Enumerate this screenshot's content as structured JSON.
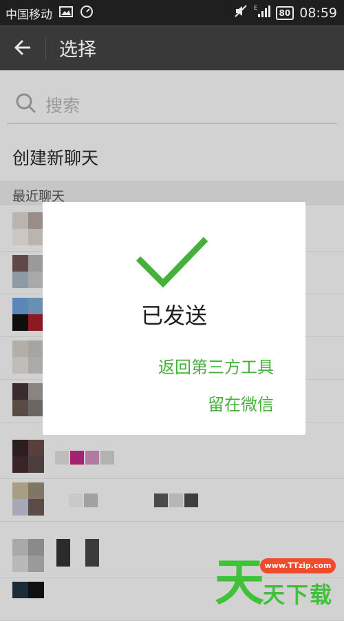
{
  "status_bar": {
    "carrier": "中国移动",
    "battery": "80",
    "time": "08:59"
  },
  "app_bar": {
    "title": "选择"
  },
  "search": {
    "placeholder": "搜索"
  },
  "create_chat_label": "创建新聊天",
  "section_header": "最近聊天",
  "dialog": {
    "status": "已发送",
    "return_label": "返回第三方工具",
    "stay_label": "留在微信"
  },
  "watermark": {
    "url": "www.TTzip.com",
    "big_char": "天",
    "text": "天下载"
  },
  "colors": {
    "accent_green": "#45b03a",
    "statusbar_bg": "#1f1f1f",
    "appbar_bg": "#393939"
  }
}
